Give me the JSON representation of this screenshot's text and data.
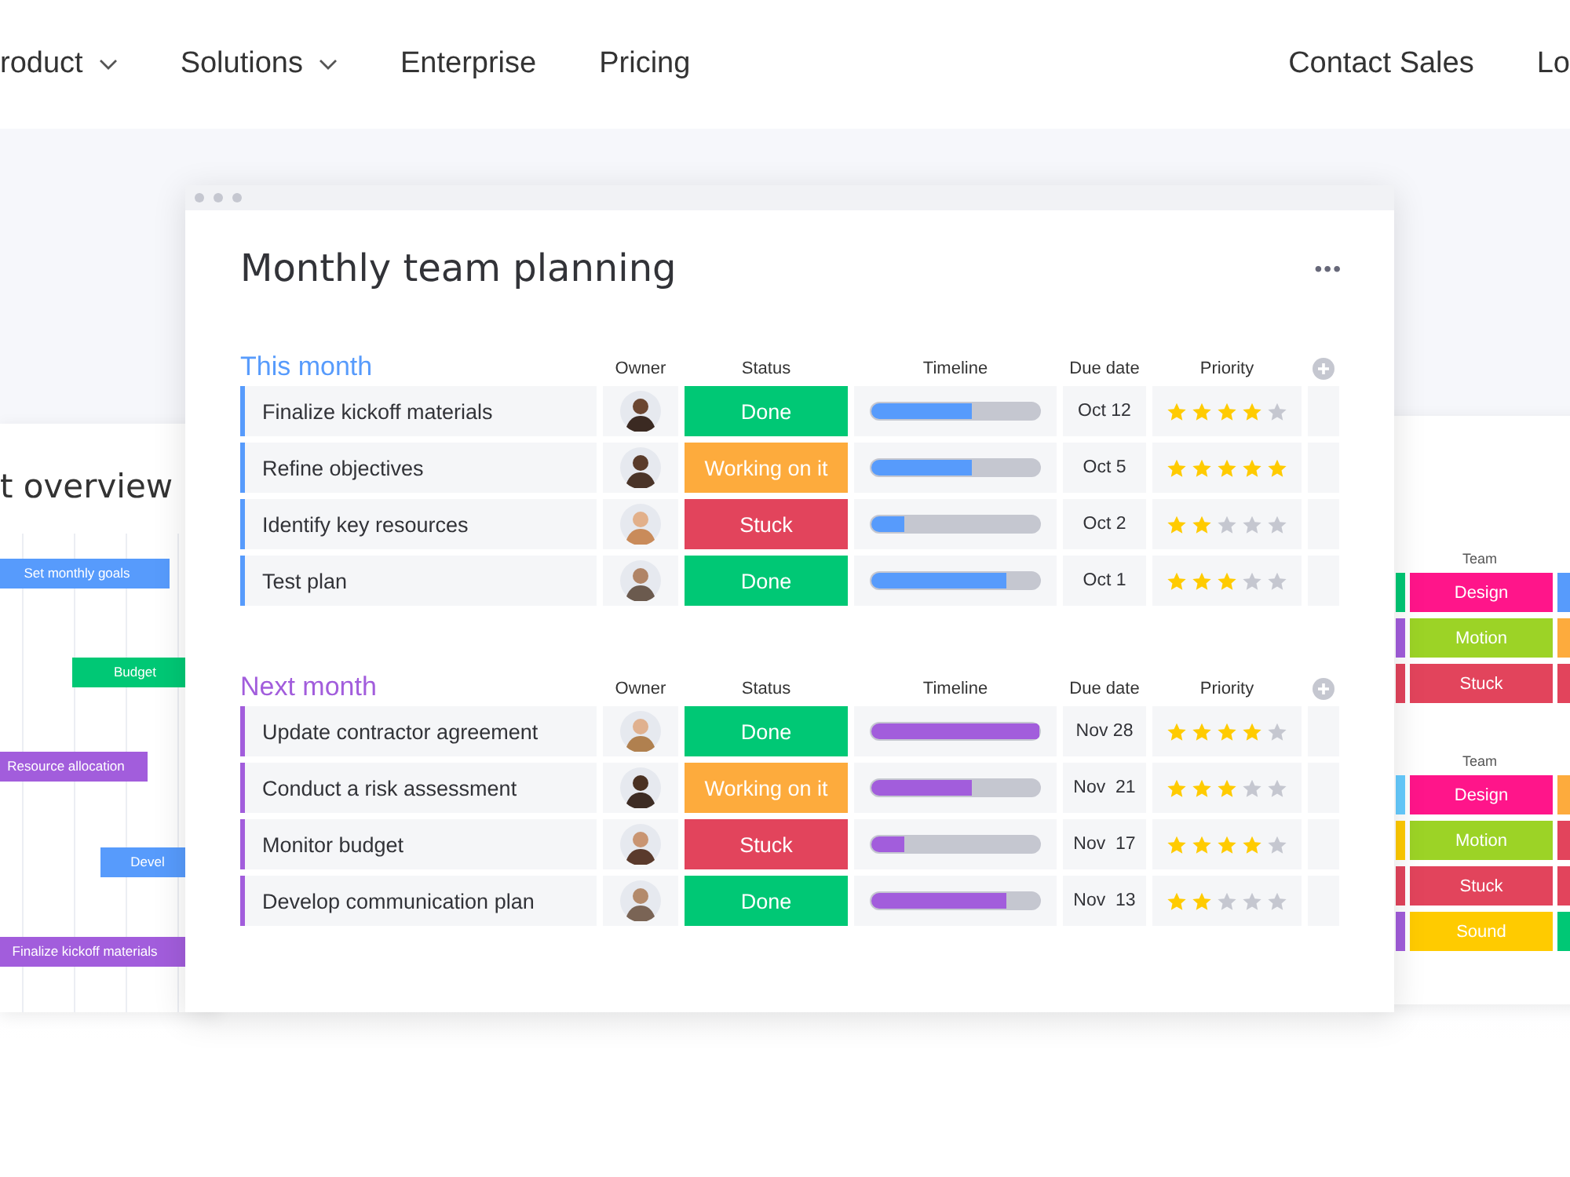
{
  "nav": {
    "left": [
      {
        "label": "roduct",
        "dropdown": true
      },
      {
        "label": "Solutions",
        "dropdown": true
      },
      {
        "label": "Enterprise",
        "dropdown": false
      },
      {
        "label": "Pricing",
        "dropdown": false
      }
    ],
    "right": [
      {
        "label": "Contact Sales"
      },
      {
        "label": "Lo"
      }
    ]
  },
  "overview": {
    "title": "t overview",
    "bars": [
      {
        "label": "Set monthly goals",
        "color": "#579bfc"
      },
      {
        "label": "Budget",
        "color": "#00c875"
      },
      {
        "label": "Resource allocation",
        "color": "#a25ddc"
      },
      {
        "label": "Devel",
        "color": "#579bfc"
      },
      {
        "label": "Finalize kickoff materials",
        "color": "#a25ddc"
      }
    ]
  },
  "board": {
    "title": "Monthly team planning",
    "menu": "•••",
    "groups": [
      {
        "title": "This month",
        "color": "#579bfc",
        "columns": [
          "Owner",
          "Status",
          "Timeline",
          "Due date",
          "Priority"
        ],
        "rows": [
          {
            "task": "Finalize kickoff materials",
            "status": "Done",
            "color": "#00c875",
            "level": 0.6,
            "due": "Oct 12",
            "stars": 4
          },
          {
            "task": "Refine objectives",
            "status": "Working on it",
            "color": "#fdab3d",
            "level": 0.6,
            "due": "Oct 5",
            "stars": 5
          },
          {
            "task": "Identify key resources",
            "status": "Stuck",
            "color": "#e2445c",
            "level": 0.2,
            "due": "Oct 2",
            "stars": 2
          },
          {
            "task": "Test plan",
            "status": "Done",
            "color": "#00c875",
            "level": 0.8,
            "due": "Oct 1",
            "stars": 3
          }
        ]
      },
      {
        "title": "Next month",
        "color": "#a25ddc",
        "columns": [
          "Owner",
          "Status",
          "Timeline",
          "Due date",
          "Priority"
        ],
        "rows": [
          {
            "task": "Update contractor agreement",
            "status": "Done",
            "color": "#00c875",
            "level": 1,
            "due": "Nov 28",
            "stars": 4
          },
          {
            "task": "Conduct a risk assessment",
            "status": "Working on it",
            "color": "#fdab3d",
            "level": 0.6,
            "due": "Nov  21",
            "stars": 3
          },
          {
            "task": "Monitor budget",
            "status": "Stuck",
            "color": "#e2445c",
            "level": 0.2,
            "due": "Nov  17",
            "stars": 4
          },
          {
            "task": "Develop communication plan",
            "status": "Done",
            "color": "#00c875",
            "level": 0.8,
            "due": "Nov  13",
            "stars": 2
          }
        ]
      }
    ]
  },
  "team_board": {
    "groups": [
      {
        "header": "Team",
        "rows": [
          {
            "label": "Design",
            "color": "#ff158a",
            "side_colors": [
              {
                "color": "#00c875"
              },
              {
                "color": "#579bfc"
              }
            ]
          },
          {
            "label": "Motion",
            "color": "#9cd326",
            "side_colors": [
              {
                "color": "#a25ddc"
              },
              {
                "color": "#fdab3d"
              }
            ]
          },
          {
            "label": "Stuck",
            "color": "#e2445c",
            "side_colors": [
              {
                "color": "#e2445c"
              },
              {
                "color": "#e2445c"
              }
            ]
          }
        ]
      },
      {
        "header": "Team",
        "rows": [
          {
            "label": "Design",
            "color": "#ff158a",
            "side_colors": [
              {
                "color": "#66ccff"
              },
              {
                "color": "#fdab3d"
              }
            ]
          },
          {
            "label": "Motion",
            "color": "#9cd326",
            "side_colors": [
              {
                "color": "#ffcb00"
              },
              {
                "color": "#e2445c"
              }
            ]
          },
          {
            "label": "Stuck",
            "color": "#e2445c",
            "side_colors": [
              {
                "color": "#e2445c"
              },
              {
                "color": "#e2445c"
              }
            ]
          },
          {
            "label": "Sound",
            "color": "#ffcb00",
            "side_colors": [
              {
                "color": "#a25ddc"
              },
              {
                "color": "#00c875"
              }
            ]
          }
        ]
      }
    ]
  }
}
